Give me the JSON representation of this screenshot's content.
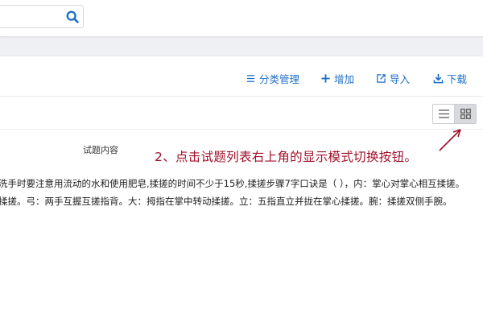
{
  "toolbar": {
    "category_label": "分类管理",
    "add_label": "增加",
    "import_label": "导入",
    "download_label": "下载"
  },
  "table": {
    "column_header": "试题内容",
    "rows": [
      "洗手时要注意用流动的水和使用肥皂,揉搓的时间不少于15秒,揉搓步骤7字口诀是（ ），内：掌心对掌心相互揉搓。",
      "揉搓。弓：两手互握互搓指背。大：拇指在掌中转动揉搓。立：五指直立并拢在掌心揉搓。腕：揉搓双侧手腕。"
    ]
  },
  "annotation": "2、点击试题列表右上角的显示模式切换按钮。",
  "colors": {
    "accent": "#1e6fc7",
    "annotation": "#a0102a"
  }
}
